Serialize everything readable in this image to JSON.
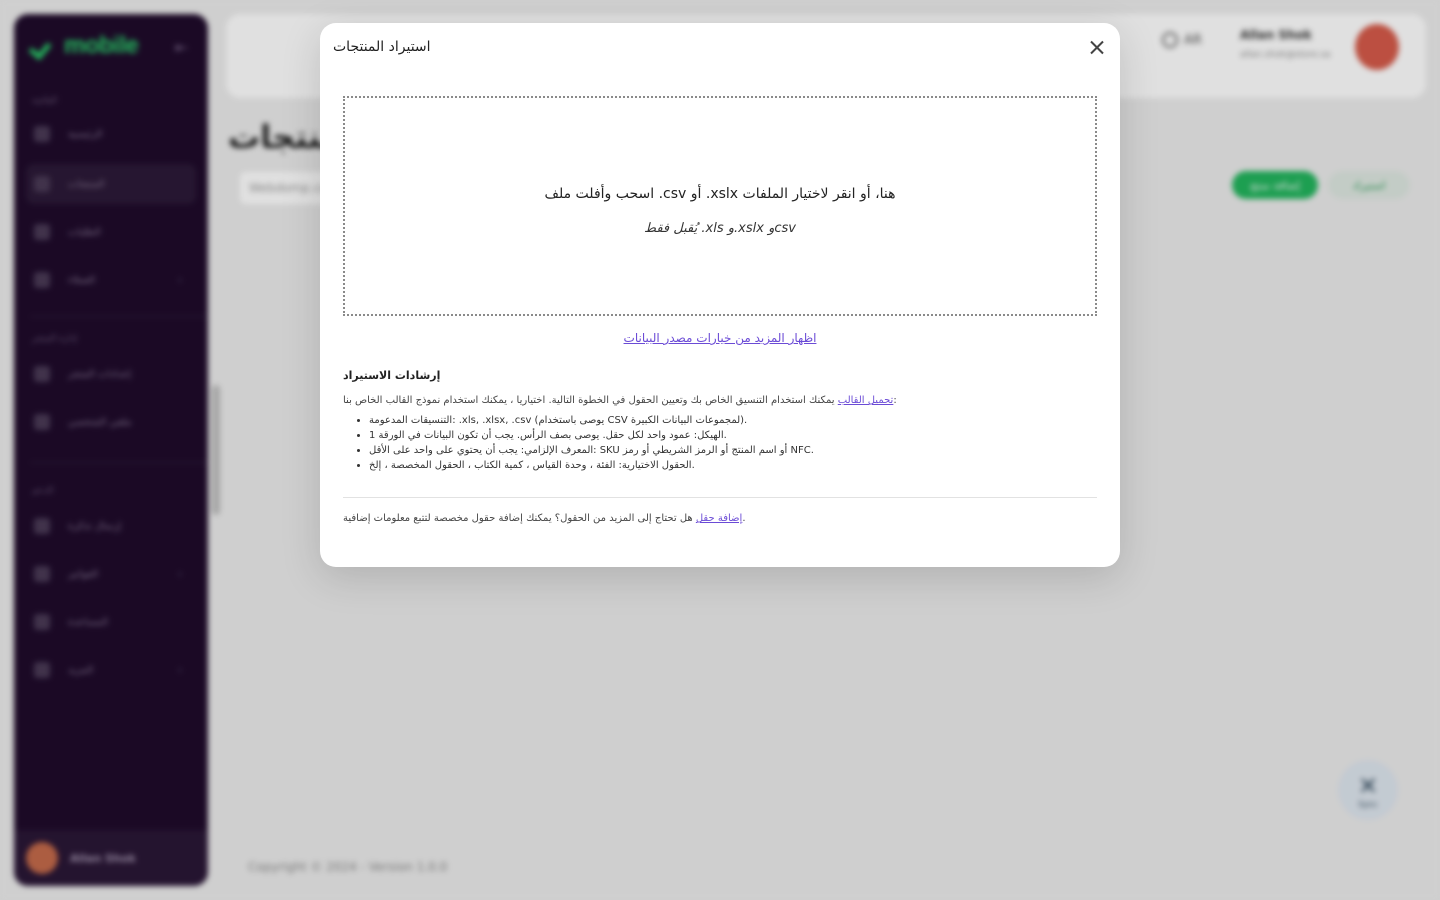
{
  "sidebar": {
    "logo": "mobile",
    "logo_sub": "",
    "sections": [
      "القائمة",
      "إدارة المتجر",
      "الدعم"
    ],
    "items": [
      {
        "label": "الرئيسية"
      },
      {
        "label": "المنتجات"
      },
      {
        "label": "الطلبات"
      },
      {
        "label": "العملاء"
      },
      {
        "label": "إعدادات المتجر"
      },
      {
        "label": "ملفي الشخصي"
      },
      {
        "label": "إرسال تذكرة"
      },
      {
        "label": "الفواتير"
      },
      {
        "label": "المساعدة"
      },
      {
        "label": "المزيد"
      }
    ],
    "user_name": "Allan Shok"
  },
  "topbar": {
    "language": "AR",
    "user_name": "Allan Shok",
    "user_email": "allan.shok@store.sa"
  },
  "page": {
    "title": "المنتجات",
    "search_placeholder": "Webdomp.com",
    "add_button": "إضافة منتج",
    "import_button": "استيراد",
    "copyright": "Copyright © 2024 - Version 1.0.0",
    "fab_label": "Sync"
  },
  "modal": {
    "title": "استيراد المنتجات",
    "dropzone_main": "اسحب وأفلت ملف .csv أو .xslx هنا، أو انقر لاختيار الملفات",
    "dropzone_sub": "يُقبل فقط .xls و.xslx وcsv",
    "more_options_link": "اظهار المزيد من خيارات مصدر البيانات",
    "guide_title": "إرشادات الاستيراد",
    "guide_intro": "يمكنك استخدام التنسيق الخاص بك وتعيين الحقول في الخطوة التالية. اختياريا ، يمكنك استخدام نموذج القالب الخاص بنا:",
    "guide_template_link": "تحميل القالب",
    "guide_items": [
      "التنسيقات المدعومة: .xls, .xlsx, .csv (يوصى باستخدام CSV لمجموعات البيانات الكبيرة).",
      "الهيكل: عمود واحد لكل حقل. يوصى بصف الرأس. يجب أن تكون البيانات في الورقة 1.",
      "المعرف الإلزامي: يجب أن يحتوي على واحد على الأقل: SKU أو اسم المنتج أو الرمز الشريطي أو رمز NFC.",
      "الحقول الاختيارية: الفئة ، وحدة القياس ، كمية الكتاب ، الحقول المخصصة ، إلخ."
    ],
    "footer_text": "هل تحتاج إلى المزيد من الحقول؟ يمكنك إضافة حقول مخصصة لتتبع معلومات إضافية.",
    "footer_link": "إضافة حقل"
  }
}
